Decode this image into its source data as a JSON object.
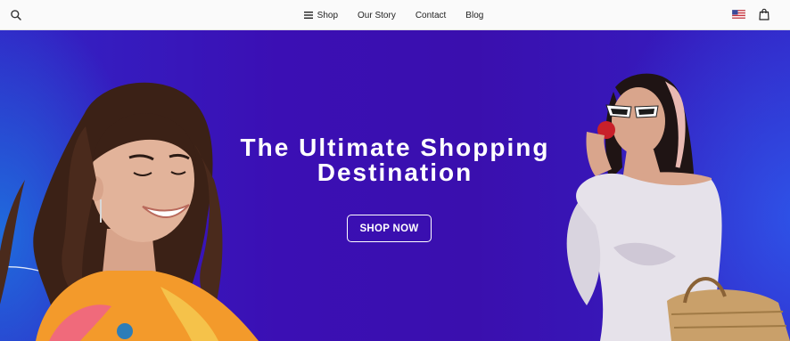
{
  "nav": {
    "items": [
      {
        "label": "Shop",
        "icon": "menu-icon"
      },
      {
        "label": "Our Story"
      },
      {
        "label": "Contact"
      },
      {
        "label": "Blog"
      }
    ],
    "icons": {
      "search": "search-icon",
      "flag": "us-flag-icon",
      "cart": "shopping-bag-icon"
    }
  },
  "hero": {
    "title_line1": "The Ultimate Shopping",
    "title_line2": "Destination",
    "cta_label": "SHOP NOW"
  },
  "colors": {
    "hero_purple": "#3a0fae",
    "hero_blue": "#2d5cee",
    "text_white": "#ffffff",
    "nav_bg": "#fafafa"
  }
}
